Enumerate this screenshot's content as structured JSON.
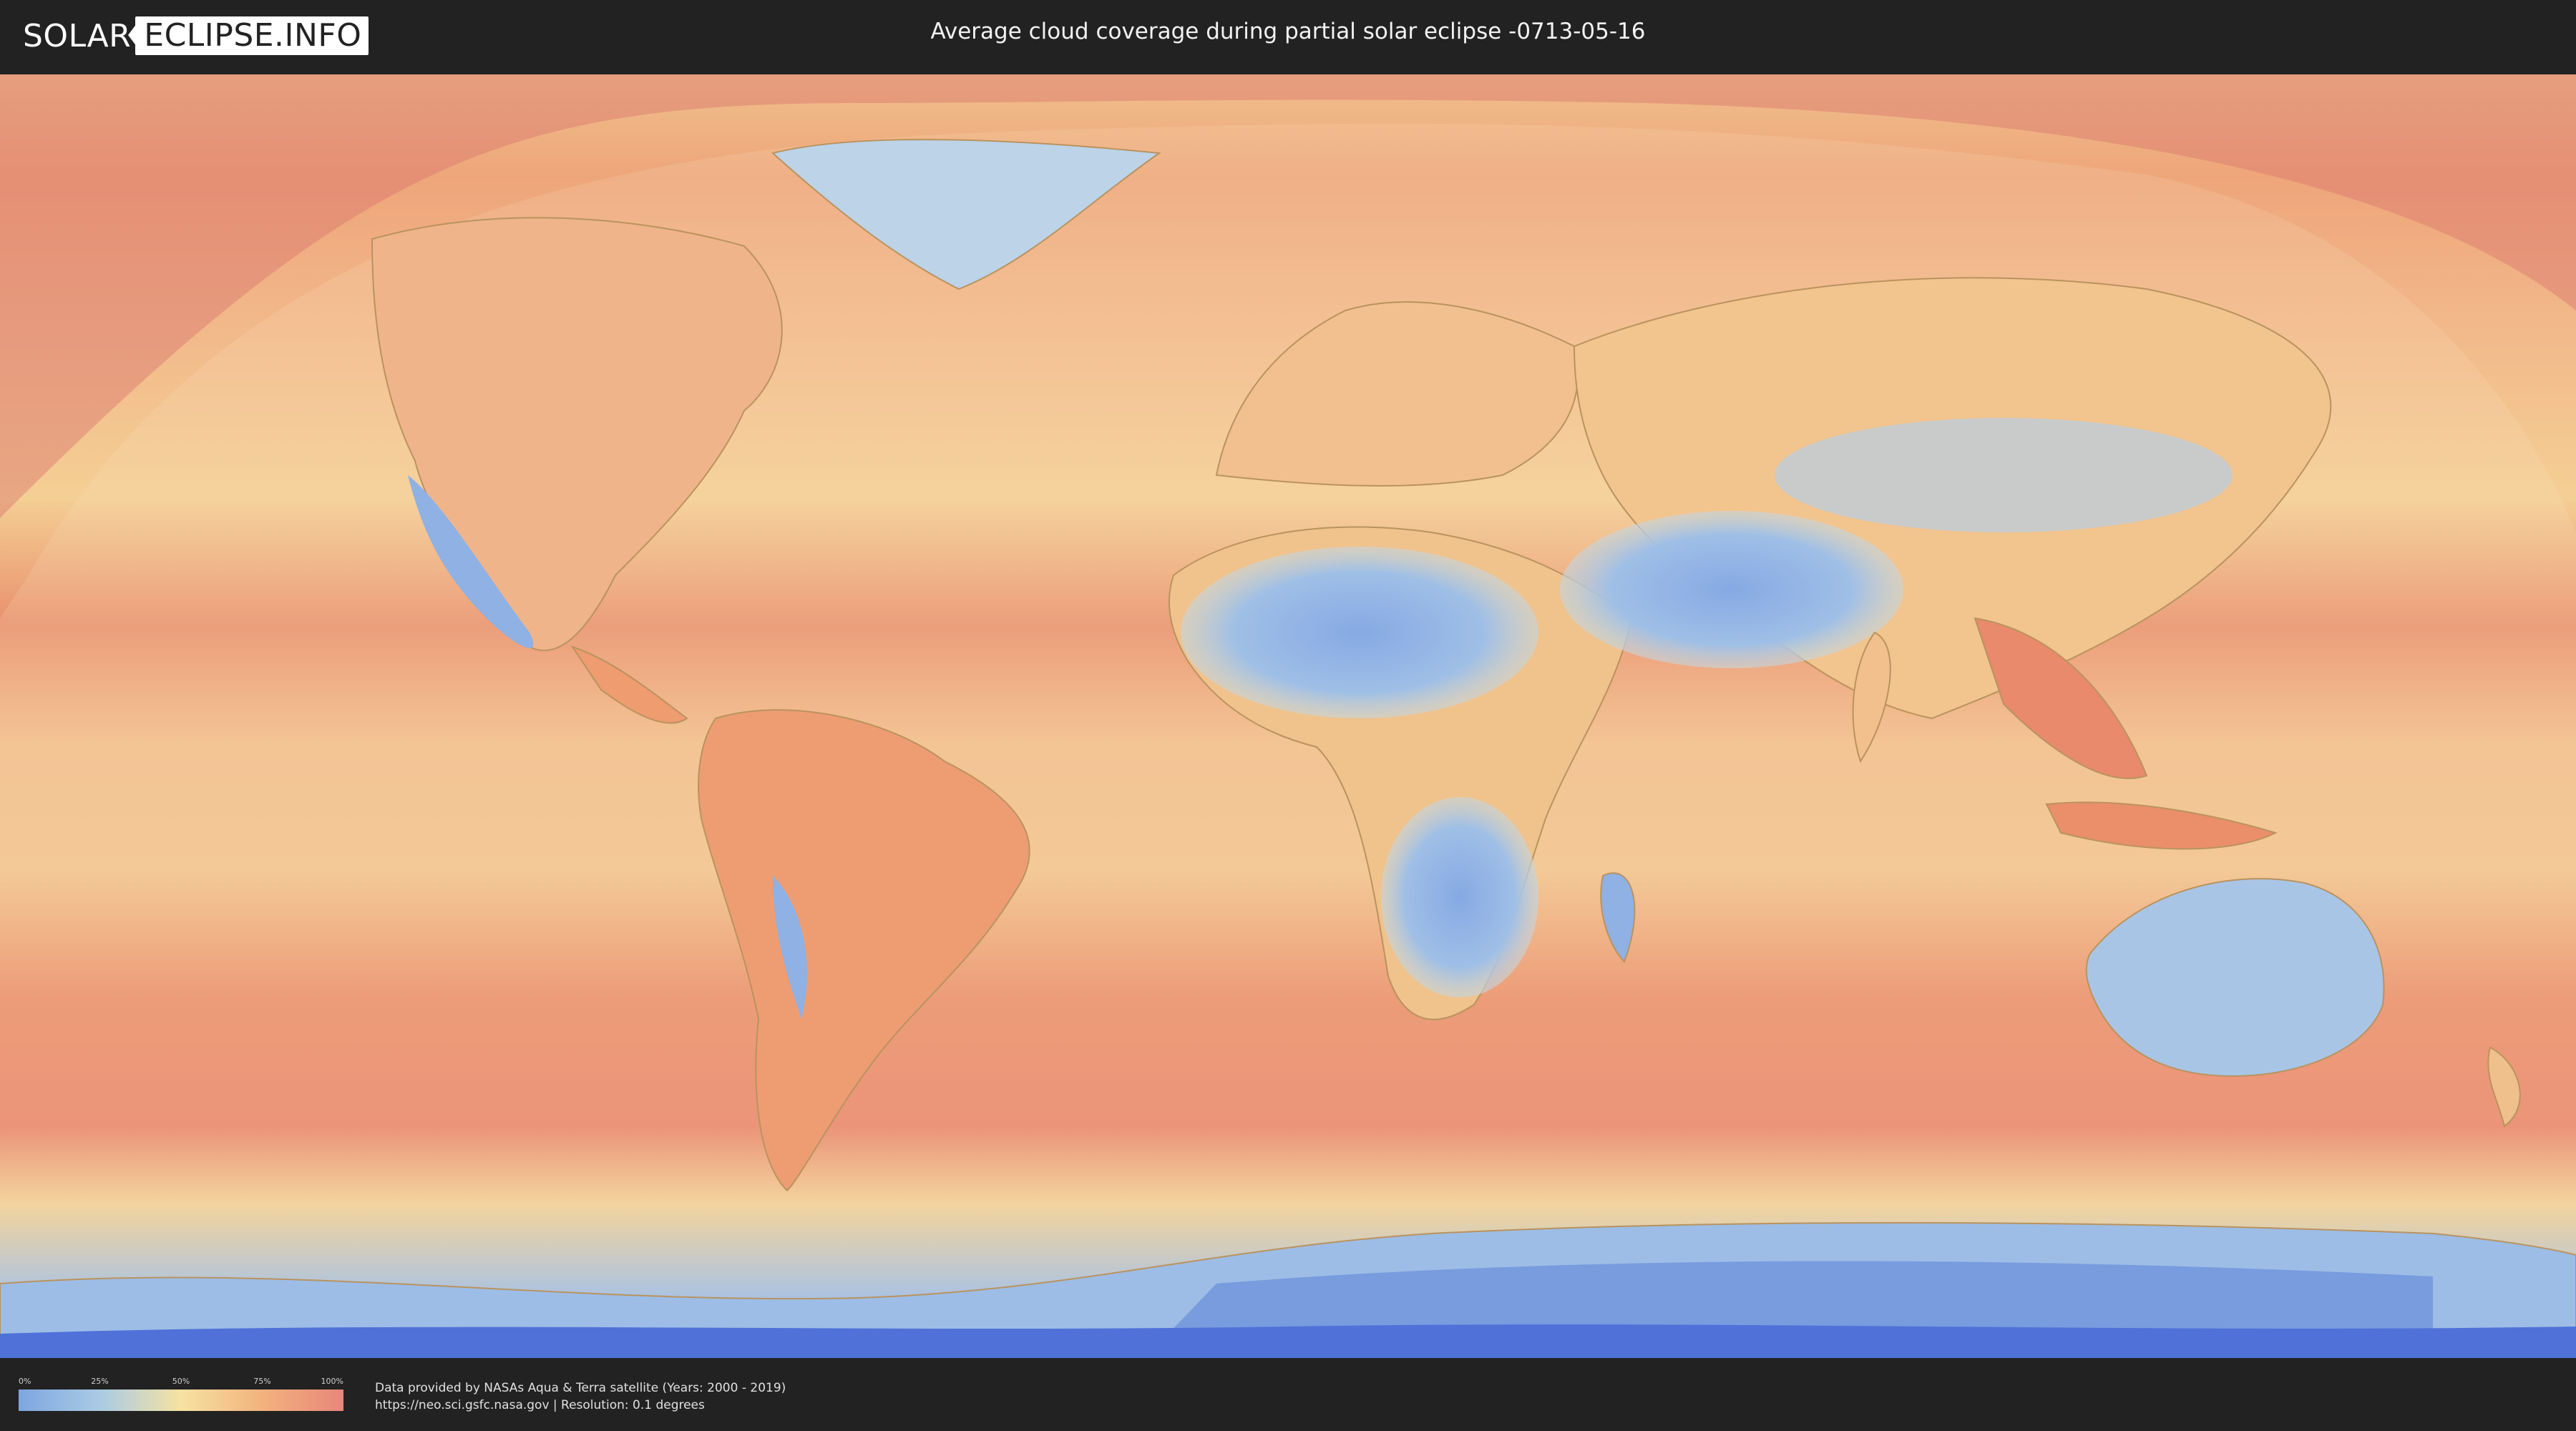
{
  "header": {
    "logo_left": "SOLAR",
    "logo_right": "ECLIPSE.INFO",
    "title": "Average cloud coverage during partial solar eclipse -0713-05-16"
  },
  "map": {
    "layer": "cloud-coverage",
    "colors": {
      "ocean_cloudy": "#e9875e",
      "mid": "#f3c386",
      "land_clear": "#8fb3e6",
      "eclipse_shadow": "#f6d6a8"
    }
  },
  "legend": {
    "ticks": [
      "0%",
      "25%",
      "50%",
      "75%",
      "100%"
    ],
    "gradient": [
      "#7ea6e0",
      "#a9cbe4",
      "#f6e2a2",
      "#f2b27e",
      "#e8867a"
    ]
  },
  "footer": {
    "credit_line": "Data provided by NASAs Aqua & Terra satellite (Years: 2000 - 2019)",
    "source_line": "https://neo.sci.gsfc.nasa.gov | Resolution: 0.1 degrees"
  }
}
